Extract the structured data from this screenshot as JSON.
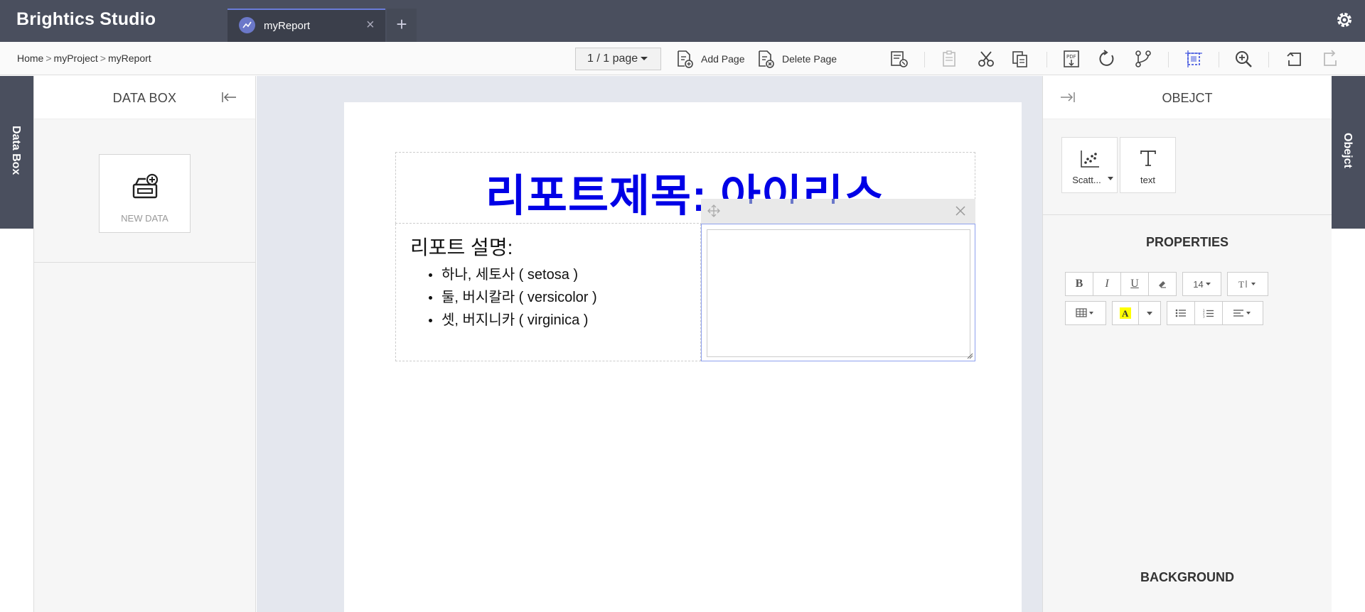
{
  "app": {
    "title": "Brightics Studio"
  },
  "tabs": [
    {
      "label": "myReport",
      "close": "×"
    }
  ],
  "tab_add": "+",
  "breadcrumb": {
    "home": "Home",
    "project": "myProject",
    "report": "myReport",
    "sep": ">"
  },
  "toolbar": {
    "page_select": "1 / 1 page",
    "add_page": "Add Page",
    "delete_page": "Delete Page",
    "icons": [
      "report-properties-icon",
      "paste-icon",
      "cut-icon",
      "copy-icon",
      "export-pdf-icon",
      "refresh-icon",
      "branch-icon",
      "select-area-icon",
      "zoom-in-icon",
      "undo-icon",
      "redo-icon"
    ]
  },
  "left_edge": {
    "label": "Data Box"
  },
  "right_edge": {
    "label": "Obejct"
  },
  "data_box": {
    "title": "DATA BOX",
    "new_data": "NEW DATA"
  },
  "report": {
    "title": "리포트제목: 아이리스",
    "description_heading": "리포트 설명:",
    "items": [
      "하나, 세토사 ( setosa )",
      "둘, 버시칼라 ( versicolor )",
      "셋, 버지니카 ( virginica )"
    ]
  },
  "object_panel": {
    "title": "OBEJCT",
    "objects": [
      {
        "label": "Scatt...",
        "icon": "scatter-chart-icon"
      },
      {
        "label": "text",
        "icon": "text-icon"
      }
    ],
    "properties_title": "PROPERTIES",
    "font_size": "14",
    "background_title": "BACKGROUND"
  },
  "colors": {
    "topbar": "#4a4f5e",
    "accent": "#6a7cd9",
    "title_blue": "#0000e6"
  }
}
